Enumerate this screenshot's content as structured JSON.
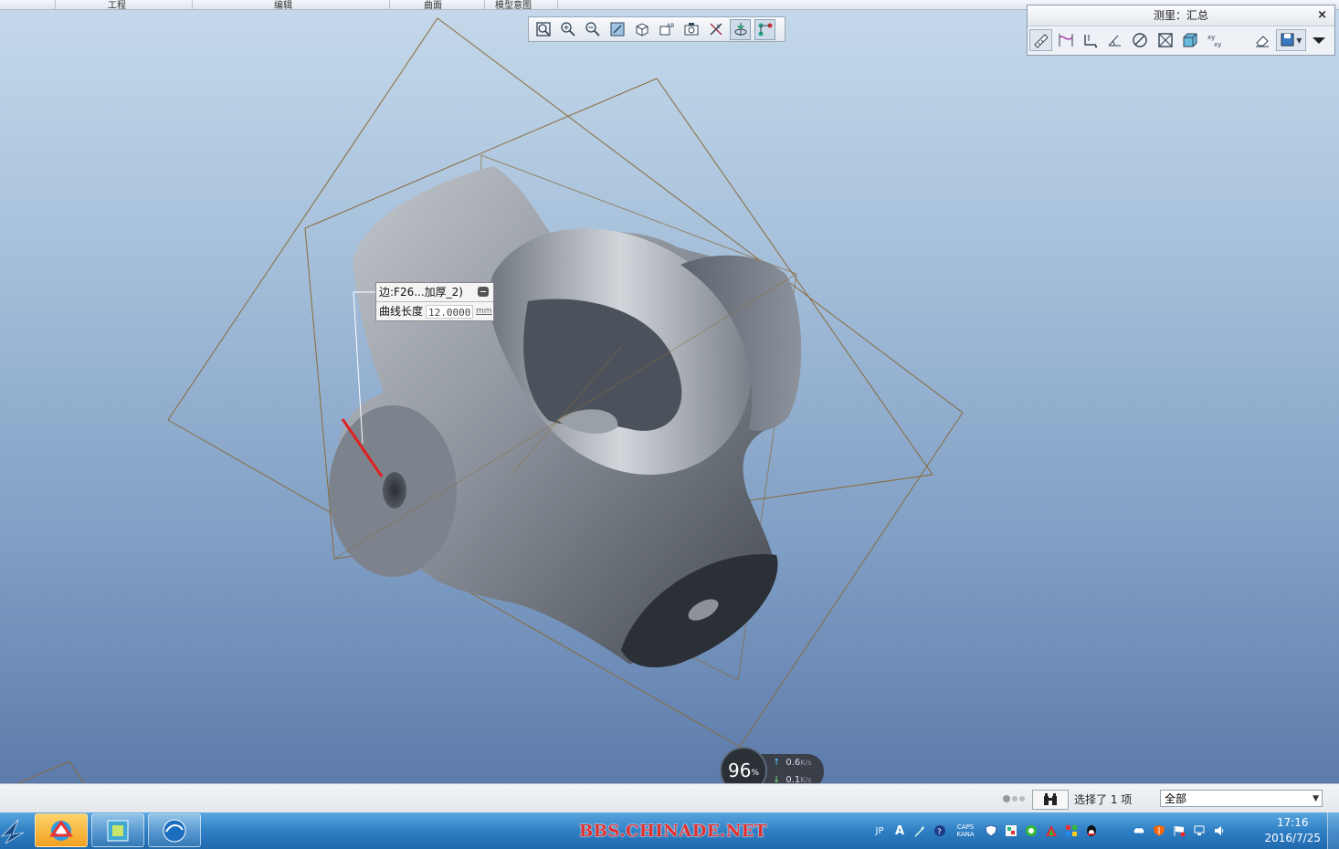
{
  "ribbon": {
    "groups": [
      "工程",
      "编辑",
      "曲面",
      "模型意图"
    ]
  },
  "graphics_toolbar": {
    "buttons": [
      "refit-icon",
      "zoom-in-icon",
      "zoom-out-icon",
      "repaint-icon",
      "display-style-icon",
      "saved-views-icon",
      "view-manager-icon",
      "datum-display-icon",
      "spin-center-icon",
      "annotation-display-icon"
    ]
  },
  "measure_panel": {
    "title": "测里：汇总",
    "close": "×",
    "tools": [
      "length-icon",
      "distance-icon",
      "angle-icon",
      "radius-icon",
      "diameter-icon",
      "area-icon",
      "volume-icon",
      "transform-icon",
      "eraser-icon",
      "save-icon"
    ]
  },
  "callout": {
    "reference": "边:F26...加厚_2)",
    "label": "曲线长度",
    "value": "12.0000",
    "unit": "mm"
  },
  "net_meter": {
    "percent": "96",
    "percent_sign": "%",
    "upload": "0.6",
    "download": "0.1",
    "rate_unit": "K/s"
  },
  "status_bar": {
    "selected_text": "选择了 1 项",
    "filter_value": "全部"
  },
  "taskbar": {
    "watermark": "BBS.CHINADE.NET",
    "tray_text": [
      "JP",
      "A",
      "CAPS",
      "KANA"
    ],
    "clock_time": "17:16",
    "clock_date": "2016/7/25"
  },
  "colors": {
    "viewport_top": "#c5d9ea",
    "viewport_bottom": "#5d7bab",
    "datum_plane": "#8a6a3a",
    "measure_highlight": "#e02020",
    "taskbar": "#2f7fc4",
    "watermark": "#e03030"
  }
}
